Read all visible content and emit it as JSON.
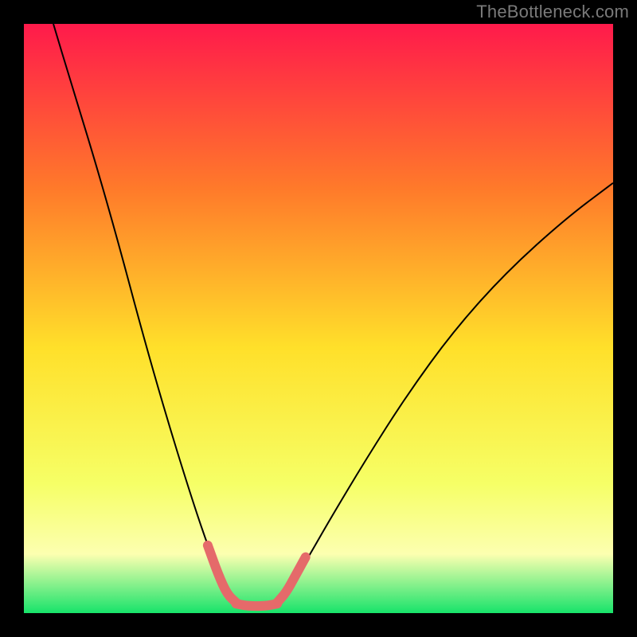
{
  "watermark": "TheBottleneck.com",
  "chart_data": {
    "type": "line",
    "title": "",
    "xlabel": "",
    "ylabel": "",
    "x_range": [
      0,
      100
    ],
    "y_range": [
      0,
      100
    ],
    "background_gradient": {
      "top": "#ff1a4b",
      "mid_upper": "#ff7a2a",
      "mid": "#ffe02a",
      "mid_lower": "#f6ff66",
      "band": "#fcffb0",
      "bottom": "#17e36a"
    },
    "series": [
      {
        "name": "bottleneck-curve",
        "color": "#000000",
        "stroke_width": 2,
        "points": [
          {
            "x": 5,
            "y": 100
          },
          {
            "x": 8,
            "y": 90
          },
          {
            "x": 12,
            "y": 77
          },
          {
            "x": 16,
            "y": 63
          },
          {
            "x": 20,
            "y": 48
          },
          {
            "x": 24,
            "y": 34
          },
          {
            "x": 28,
            "y": 21
          },
          {
            "x": 31,
            "y": 12
          },
          {
            "x": 33.5,
            "y": 5.5
          },
          {
            "x": 35.5,
            "y": 2.2
          },
          {
            "x": 38,
            "y": 1.2
          },
          {
            "x": 41,
            "y": 1.2
          },
          {
            "x": 43.5,
            "y": 2.2
          },
          {
            "x": 45.5,
            "y": 5
          },
          {
            "x": 48,
            "y": 9
          },
          {
            "x": 52,
            "y": 16
          },
          {
            "x": 58,
            "y": 26
          },
          {
            "x": 65,
            "y": 37
          },
          {
            "x": 73,
            "y": 48
          },
          {
            "x": 82,
            "y": 58
          },
          {
            "x": 92,
            "y": 67
          },
          {
            "x": 100,
            "y": 73
          }
        ]
      },
      {
        "name": "highlight-left-arm",
        "color": "#e56a6a",
        "stroke_width": 12,
        "round_caps": true,
        "points": [
          {
            "x": 31.2,
            "y": 11.5
          },
          {
            "x": 33,
            "y": 6.5
          },
          {
            "x": 34.5,
            "y": 3.2
          },
          {
            "x": 36,
            "y": 1.8
          }
        ]
      },
      {
        "name": "highlight-bottom",
        "color": "#e56a6a",
        "stroke_width": 12,
        "round_caps": true,
        "points": [
          {
            "x": 36,
            "y": 1.6
          },
          {
            "x": 38,
            "y": 1.2
          },
          {
            "x": 41,
            "y": 1.2
          },
          {
            "x": 43,
            "y": 1.6
          }
        ]
      },
      {
        "name": "highlight-right-arm",
        "color": "#e56a6a",
        "stroke_width": 12,
        "round_caps": true,
        "points": [
          {
            "x": 43,
            "y": 1.8
          },
          {
            "x": 44.5,
            "y": 3.5
          },
          {
            "x": 46,
            "y": 6.2
          },
          {
            "x": 47.8,
            "y": 9.5
          }
        ]
      }
    ]
  }
}
